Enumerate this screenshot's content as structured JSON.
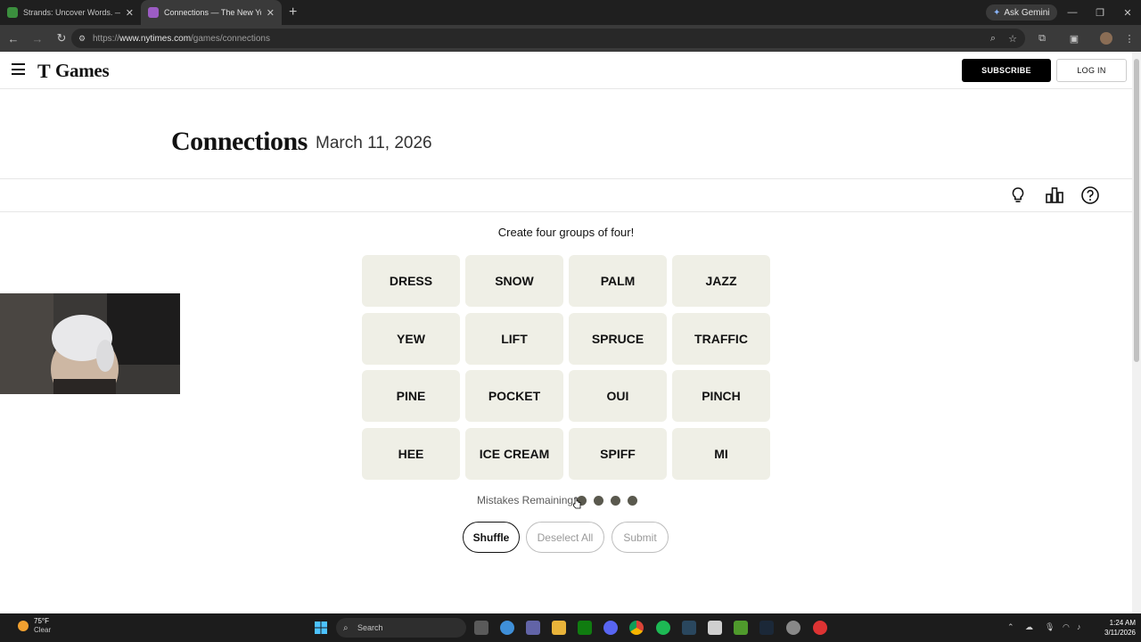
{
  "browser": {
    "tabs": [
      {
        "title": "Strands: Uncover Words. — The",
        "active": false,
        "favicon_color": "#4caf50"
      },
      {
        "title": "Connections — The New York T",
        "active": true,
        "favicon_color": "#b066d6"
      }
    ],
    "ask_gemini": "Ask Gemini",
    "url_prefix": "https://",
    "url_host": "www.nytimes.com",
    "url_path": "/games/connections"
  },
  "site": {
    "logo_mark": "T",
    "logo_text": "Games",
    "subscribe": "SUBSCRIBE",
    "login": "LOG IN"
  },
  "game": {
    "title": "Connections",
    "date": "March 11, 2026",
    "prompt": "Create four groups of four!",
    "tiles": [
      "DRESS",
      "SNOW",
      "PALM",
      "JAZZ",
      "YEW",
      "LIFT",
      "SPRUCE",
      "TRAFFIC",
      "PINE",
      "POCKET",
      "OUI",
      "PINCH",
      "HEE",
      "ICE CREAM",
      "SPIFF",
      "MI"
    ],
    "mistakes_label": "Mistakes Remaining:",
    "mistakes_remaining": 4,
    "buttons": {
      "shuffle": "Shuffle",
      "deselect": "Deselect All",
      "submit": "Submit"
    }
  },
  "taskbar": {
    "temperature": "75°F",
    "condition": "Clear",
    "search": "Search",
    "time": "1:24 AM",
    "date": "3/11/2026"
  }
}
